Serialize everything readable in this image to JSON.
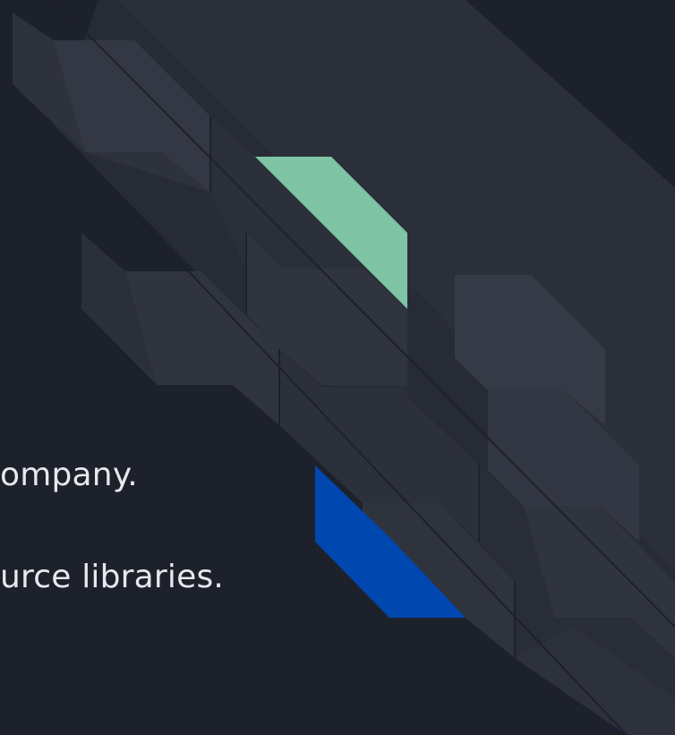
{
  "slide": {
    "lines": [
      "ompany.",
      "urce libraries."
    ]
  },
  "colors": {
    "background": "#1d212b",
    "panel_dark": "#2a2e39",
    "panel_light": "#353946",
    "accent_green": "#7fc4a4",
    "accent_blue": "#0047b0",
    "text": "#e6e8ec"
  }
}
